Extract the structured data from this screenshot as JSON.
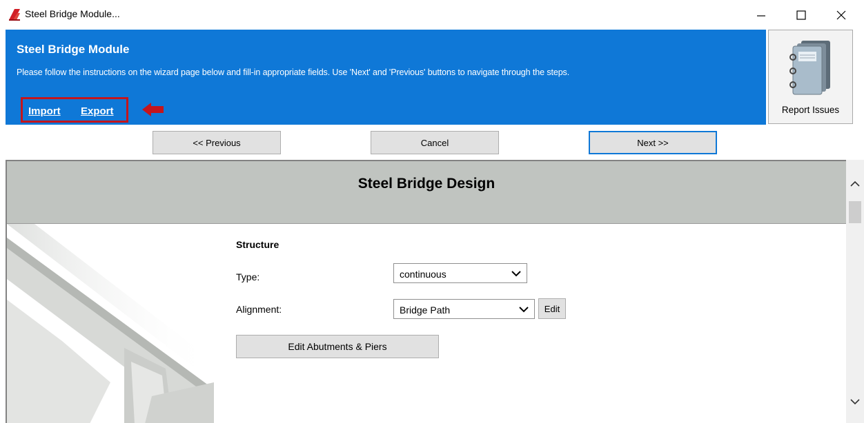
{
  "window": {
    "title": "Steel Bridge Module..."
  },
  "header": {
    "title": "Steel Bridge Module",
    "description": "Please follow the instructions on the wizard page below and fill-in appropriate fields. Use 'Next' and 'Previous' buttons to navigate through the steps.",
    "import_label": "Import",
    "export_label": "Export",
    "report_label": "Report Issues"
  },
  "nav": {
    "previous_label": "<< Previous",
    "cancel_label": "Cancel",
    "next_label": "Next >>"
  },
  "content": {
    "title": "Steel Bridge Design",
    "section_title": "Structure",
    "type_label": "Type:",
    "type_value": "continuous",
    "alignment_label": "Alignment:",
    "alignment_value": "Bridge Path",
    "edit_label": "Edit",
    "abutments_label": "Edit Abutments & Piers"
  },
  "colors": {
    "header_blue": "#0f78d7",
    "highlight_red": "#c4151c",
    "panel_gray": "#c0c4c0"
  }
}
